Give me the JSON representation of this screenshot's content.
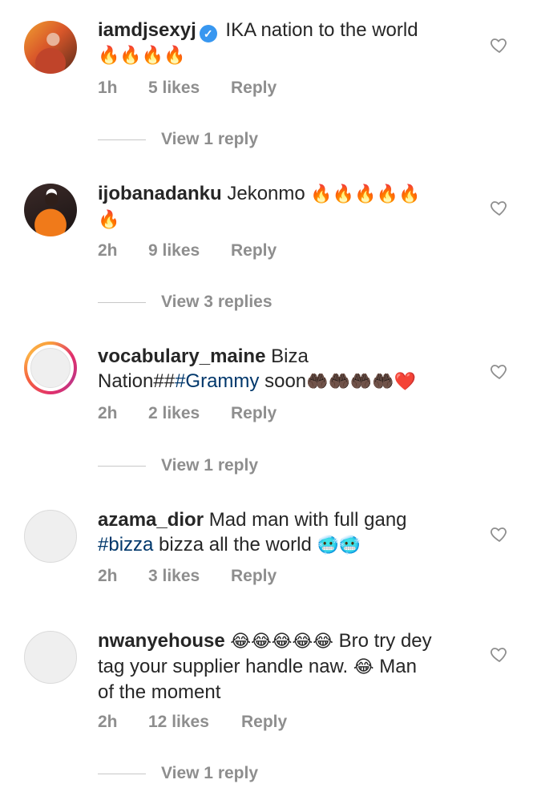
{
  "comments": [
    {
      "username": "iamdjsexyj",
      "verified": true,
      "text_parts": [
        "IKA nation to the world",
        "🔥🔥🔥🔥"
      ],
      "time": "1h",
      "likes": "5 likes",
      "reply_label": "Reply",
      "view_replies": "View 1 reply",
      "avatar_icon": "profile-photo"
    },
    {
      "username": "ijobanadanku",
      "verified": false,
      "text_parts": [
        "Jekonmo",
        "🔥🔥🔥🔥🔥",
        "🔥"
      ],
      "time": "2h",
      "likes": "9 likes",
      "reply_label": "Reply",
      "view_replies": "View 3 replies",
      "avatar_icon": "profile-photo"
    },
    {
      "username": "vocabulary_maine",
      "verified": false,
      "text_parts": [
        "Biza",
        "Nation##",
        "#Grammy",
        "soon",
        "🤲🏿🤲🏿🤲🏿🤲🏿❤️"
      ],
      "time": "2h",
      "likes": "2 likes",
      "reply_label": "Reply",
      "view_replies": "View 1 reply",
      "avatar_icon": "story-ring-avatar"
    },
    {
      "username": "azama_dior",
      "verified": false,
      "text_parts": [
        "Mad man with full gang",
        "#bizza",
        "bizza all the world",
        "🥶🥶"
      ],
      "time": "2h",
      "likes": "3 likes",
      "reply_label": "Reply",
      "view_replies": null,
      "avatar_icon": "default-avatar"
    },
    {
      "username": "nwanyehouse",
      "verified": false,
      "text_parts": [
        "😂😂😂😂😂",
        "Bro try dey",
        "tag your supplier handle naw.",
        "😂",
        "Man",
        "of the moment"
      ],
      "time": "2h",
      "likes": "12 likes",
      "reply_label": "Reply",
      "view_replies": "View 1 reply",
      "avatar_icon": "default-avatar"
    }
  ],
  "icons": {
    "like": "heart-outline-icon",
    "verified": "verified-badge-icon"
  },
  "colors": {
    "hashtag": "#00376b",
    "muted": "#8e8e8e",
    "verified": "#3897f0"
  }
}
